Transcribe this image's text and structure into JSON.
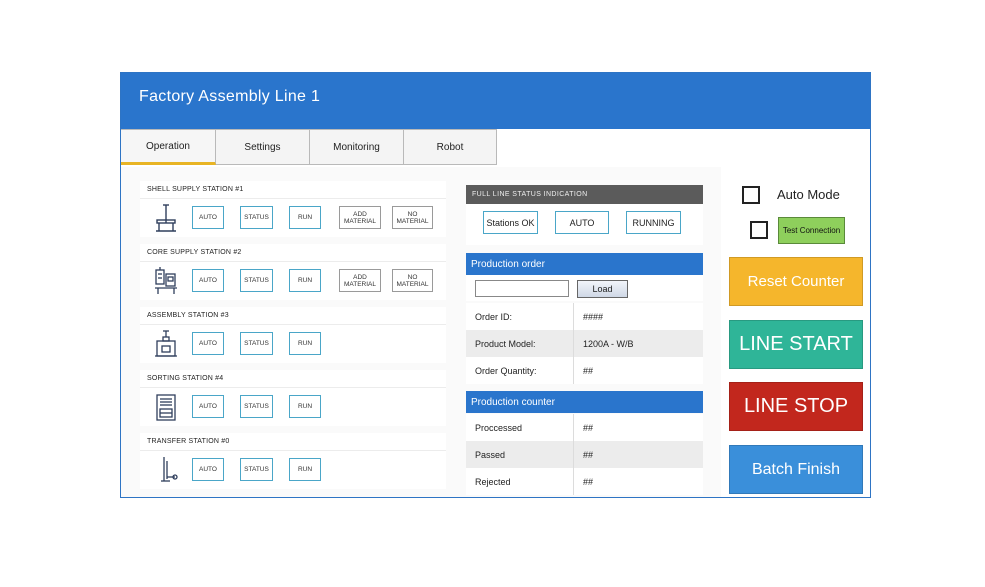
{
  "window": {
    "title": "Factory Assembly Line 1"
  },
  "tabs": [
    {
      "label": "Operation",
      "active": true
    },
    {
      "label": "Settings"
    },
    {
      "label": "Monitoring"
    },
    {
      "label": "Robot"
    }
  ],
  "stations": [
    {
      "name": "SHELL SUPPLY STATION  #1",
      "icon": "stand-icon",
      "buttons": [
        "AUTO",
        "STATUS",
        "RUN",
        "ADD MATERIAL",
        "NO MATERIAL"
      ]
    },
    {
      "name": "CORE SUPPLY STATION #2",
      "icon": "dispenser-icon",
      "buttons": [
        "AUTO",
        "STATUS",
        "RUN",
        "ADD MATERIAL",
        "NO MATERIAL"
      ]
    },
    {
      "name": "ASSEMBLY STATION #3",
      "icon": "press-icon",
      "buttons": [
        "AUTO",
        "STATUS",
        "RUN"
      ]
    },
    {
      "name": "SORTING STATION #4",
      "icon": "cabinet-icon",
      "buttons": [
        "AUTO",
        "STATUS",
        "RUN"
      ]
    },
    {
      "name": "TRANSFER STATION #0",
      "icon": "arm-icon",
      "buttons": [
        "AUTO",
        "STATUS",
        "RUN"
      ]
    }
  ],
  "full_line": {
    "heading": "FULL LINE STATUS INDICATION",
    "indicators": [
      "Stations OK",
      "AUTO",
      "RUNNING"
    ]
  },
  "production_order": {
    "heading": "Production order",
    "input_value": "",
    "load_label": "Load",
    "rows": [
      {
        "label": "Order ID:",
        "value": "####"
      },
      {
        "label": "Product Model:",
        "value": "1200A - W/B"
      },
      {
        "label": "Order Quantity:",
        "value": "##"
      }
    ]
  },
  "production_counter": {
    "heading": "Production counter",
    "rows": [
      {
        "label": "Proccessed",
        "value": "##"
      },
      {
        "label": "Passed",
        "value": "##"
      },
      {
        "label": "Rejected",
        "value": "##"
      }
    ]
  },
  "controls": {
    "auto_mode_label": "Auto Mode",
    "auto_mode_checked": false,
    "test_connection_checked": false,
    "test_connection_label": "Test Connection",
    "reset_counter_label": "Reset Counter",
    "line_start_label": "LINE START",
    "line_stop_label": "LINE STOP",
    "batch_finish_label": "Batch Finish"
  },
  "colors": {
    "header_blue": "#2a75cc",
    "tab_accent": "#e8b424",
    "reset_orange": "#f5b62c",
    "start_green": "#2fb598",
    "stop_red": "#c2271d",
    "batch_blue": "#3a8fda",
    "test_green": "#8ecf5c"
  }
}
